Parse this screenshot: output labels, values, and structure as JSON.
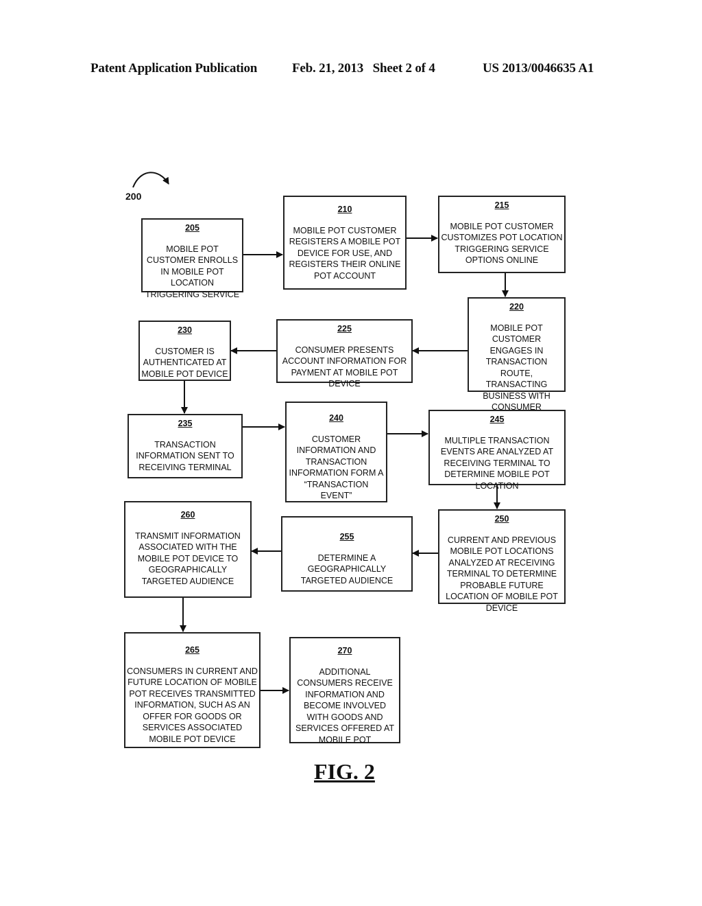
{
  "header": {
    "publication": "Patent Application Publication",
    "date_sheet": "Feb. 21, 2013   Sheet 2 of 4",
    "number": "US 2013/0046635 A1"
  },
  "figure": {
    "ref": "200",
    "label": "FIG. 2"
  },
  "steps": {
    "s205": {
      "num": "205",
      "text": "MOBILE POT CUSTOMER ENROLLS IN MOBILE POT LOCATION TRIGGERING SERVICE"
    },
    "s210": {
      "num": "210",
      "text": "MOBILE POT CUSTOMER REGISTERS A MOBILE POT DEVICE FOR USE, AND REGISTERS THEIR ONLINE POT ACCOUNT"
    },
    "s215": {
      "num": "215",
      "text": "MOBILE POT CUSTOMER CUSTOMIZES POT LOCATION TRIGGERING SERVICE OPTIONS ONLINE"
    },
    "s220": {
      "num": "220",
      "text": "MOBILE POT CUSTOMER ENGAGES IN TRANSACTION ROUTE, TRANSACTING BUSINESS WITH CONSUMER"
    },
    "s225": {
      "num": "225",
      "text": "CONSUMER PRESENTS ACCOUNT INFORMATION FOR PAYMENT AT MOBILE POT DEVICE"
    },
    "s230": {
      "num": "230",
      "text": "CUSTOMER IS AUTHENTICATED AT MOBILE POT DEVICE"
    },
    "s235": {
      "num": "235",
      "text": "TRANSACTION INFORMATION SENT TO RECEIVING TERMINAL"
    },
    "s240": {
      "num": "240",
      "text": "CUSTOMER INFORMATION AND TRANSACTION INFORMATION FORM A “TRANSACTION EVENT”"
    },
    "s245": {
      "num": "245",
      "text": "MULTIPLE TRANSACTION EVENTS ARE ANALYZED AT RECEIVING TERMINAL TO DETERMINE MOBILE POT LOCATION"
    },
    "s250": {
      "num": "250",
      "text": "CURRENT AND PREVIOUS MOBILE POT LOCATIONS ANALYZED AT RECEIVING TERMINAL TO DETERMINE PROBABLE FUTURE LOCATION OF MOBILE POT DEVICE"
    },
    "s255": {
      "num": "255",
      "text": "DETERMINE A GEOGRAPHICALLY TARGETED AUDIENCE"
    },
    "s260": {
      "num": "260",
      "text": "TRANSMIT INFORMATION ASSOCIATED WITH THE MOBILE POT DEVICE TO GEOGRAPHICALLY TARGETED AUDIENCE"
    },
    "s265": {
      "num": "265",
      "text": "CONSUMERS IN CURRENT AND FUTURE LOCATION OF MOBILE POT RECEIVES TRANSMITTED INFORMATION, SUCH AS AN OFFER FOR GOODS OR SERVICES ASSOCIATED MOBILE POT DEVICE"
    },
    "s270": {
      "num": "270",
      "text": "ADDITIONAL CONSUMERS RECEIVE INFORMATION AND BECOME INVOLVED WITH GOODS AND SERVICES OFFERED AT MOBILE POT"
    }
  },
  "flow": [
    [
      "205",
      "210"
    ],
    [
      "210",
      "215"
    ],
    [
      "215",
      "220"
    ],
    [
      "220",
      "225"
    ],
    [
      "225",
      "230"
    ],
    [
      "230",
      "235"
    ],
    [
      "235",
      "240"
    ],
    [
      "240",
      "245"
    ],
    [
      "245",
      "250"
    ],
    [
      "250",
      "255"
    ],
    [
      "255",
      "260"
    ],
    [
      "260",
      "265"
    ],
    [
      "265",
      "270"
    ]
  ]
}
